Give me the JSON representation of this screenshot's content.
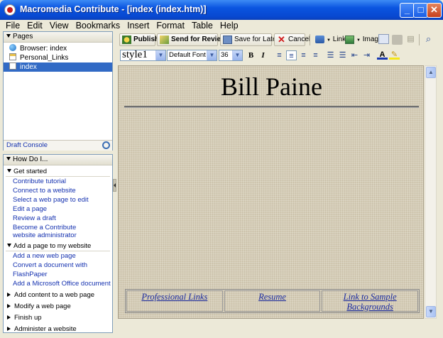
{
  "window": {
    "title": "Macromedia Contribute - [index (index.htm)]",
    "minimize": "_",
    "maximize": "□",
    "close": "✕"
  },
  "menu": [
    "File",
    "Edit",
    "View",
    "Bookmarks",
    "Insert",
    "Format",
    "Table",
    "Help"
  ],
  "pages_panel": {
    "header": "Pages",
    "items": [
      {
        "label": "Browser: index",
        "icon": "globe-icon"
      },
      {
        "label": "Personal_Links",
        "icon": "page-icon"
      },
      {
        "label": "index",
        "icon": "page-icon",
        "selected": true
      }
    ],
    "draft_console": "Draft Console"
  },
  "howdoi_panel": {
    "header": "How Do I...",
    "sections": [
      {
        "title": "Get started",
        "expanded": true,
        "links": [
          "Contribute tutorial",
          "Connect to a website",
          "Select a web page to edit",
          "Edit a page",
          "Review a draft",
          "Become a Contribute website administrator"
        ]
      },
      {
        "title": "Add a page to my website",
        "expanded": true,
        "links": [
          "Add a new web page",
          "Convert a document with FlashPaper",
          "Add a Microsoft Office document"
        ]
      },
      {
        "title": "Add content to a web page",
        "expanded": false,
        "links": []
      },
      {
        "title": "Modify a web page",
        "expanded": false,
        "links": []
      },
      {
        "title": "Finish up",
        "expanded": false,
        "links": []
      },
      {
        "title": "Administer a website",
        "expanded": false,
        "links": []
      }
    ]
  },
  "toolbar": {
    "publish": "Publish",
    "send_review": "Send for Review",
    "save_later": "Save for Later",
    "cancel": "Cancel",
    "link": "Link",
    "image": "Image"
  },
  "format_bar": {
    "style": "style1",
    "font": "Default Font",
    "size": "36",
    "bold": "B",
    "italic": "I"
  },
  "document": {
    "heading": "Bill Paine",
    "nav_links": [
      "Professional Links",
      "Resume",
      "Link to Sample Backgrounds"
    ]
  },
  "colors": {
    "selection": "#316ac5",
    "link": "#1532b0",
    "titlebar": "#0a54e0"
  }
}
